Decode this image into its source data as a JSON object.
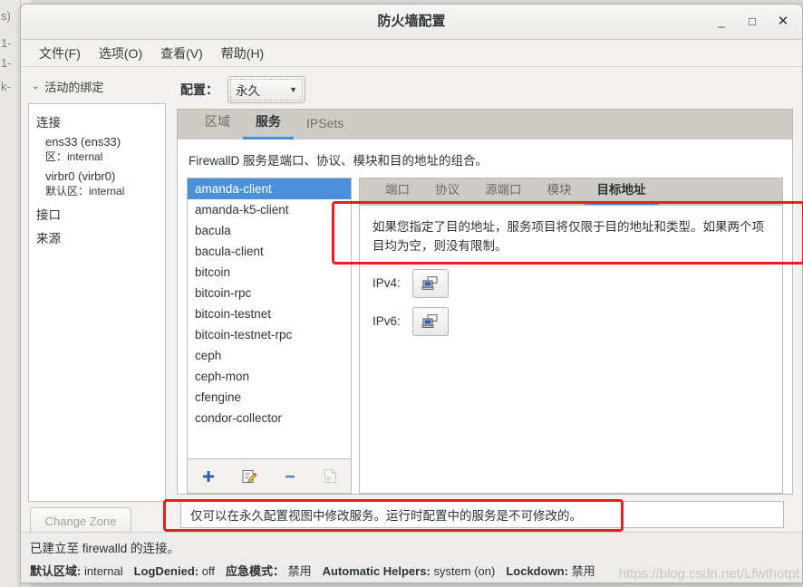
{
  "background": {
    "fragments": [
      "s)",
      "1-",
      "1-",
      "k-"
    ]
  },
  "window": {
    "title": "防火墙配置",
    "minimize_label": "_",
    "maximize_label": "□",
    "close_label": "✕"
  },
  "menubar": {
    "items": [
      {
        "label": "文件(F)"
      },
      {
        "label": "选项(O)"
      },
      {
        "label": "查看(V)"
      },
      {
        "label": "帮助(H)"
      }
    ]
  },
  "sidebar": {
    "binding_header": "活动的绑定",
    "chevron": "⌄",
    "tree": [
      {
        "label": "连接"
      },
      {
        "name": "ens33 (ens33)",
        "sub": "区：internal"
      },
      {
        "name": "virbr0 (virbr0)",
        "sub": "默认区：internal"
      },
      {
        "label": "接口"
      },
      {
        "label": "来源"
      }
    ],
    "change_zone_label": "Change Zone"
  },
  "config": {
    "label": "配置：",
    "selected": "永久",
    "arrow": "▼"
  },
  "notebook": {
    "tabs": [
      {
        "label": "区域",
        "active": false
      },
      {
        "label": "服务",
        "active": true
      },
      {
        "label": "IPSets",
        "active": false
      }
    ],
    "description": "FirewallD 服务是端口、协议、模块和目的地址的组合。"
  },
  "services": {
    "items": [
      {
        "label": "amanda-client",
        "selected": true
      },
      {
        "label": "amanda-k5-client",
        "selected": false
      },
      {
        "label": "bacula",
        "selected": false
      },
      {
        "label": "bacula-client",
        "selected": false
      },
      {
        "label": "bitcoin",
        "selected": false
      },
      {
        "label": "bitcoin-rpc",
        "selected": false
      },
      {
        "label": "bitcoin-testnet",
        "selected": false
      },
      {
        "label": "bitcoin-testnet-rpc",
        "selected": false
      },
      {
        "label": "ceph",
        "selected": false
      },
      {
        "label": "ceph-mon",
        "selected": false
      },
      {
        "label": "cfengine",
        "selected": false
      },
      {
        "label": "condor-collector",
        "selected": false
      }
    ],
    "toolbar": [
      {
        "icon": "add-icon",
        "glyph": "✚",
        "disabled": false
      },
      {
        "icon": "edit-icon",
        "glyph": "✎",
        "disabled": false
      },
      {
        "icon": "remove-icon",
        "glyph": "▬",
        "disabled": false
      },
      {
        "icon": "load-defaults-icon",
        "glyph": "⮐",
        "disabled": true
      }
    ]
  },
  "detail": {
    "tabs": [
      {
        "label": "端口",
        "active": false
      },
      {
        "label": "协议",
        "active": false
      },
      {
        "label": "源端口",
        "active": false
      },
      {
        "label": "模块",
        "active": false
      },
      {
        "label": "目标地址",
        "active": true
      }
    ],
    "hint": "如果您指定了目的地址，服务项目将仅限于目的地址和类型。如果两个项目均为空，则没有限制。",
    "ipv4_label": "IPv4:",
    "ipv4_value": "",
    "ipv6_label": "IPv6:",
    "ipv6_value": ""
  },
  "hintbar": {
    "text": "仅可以在永久配置视图中修改服务。运行时配置中的服务是不可修改的。"
  },
  "statusbar": {
    "connection": "已建立至 firewalld 的连接。",
    "fields": [
      {
        "key": "默认区域:",
        "value": "internal"
      },
      {
        "key": "LogDenied:",
        "value": "off"
      },
      {
        "key": "应急模式：",
        "value": "禁用"
      },
      {
        "key": "Automatic Helpers:",
        "value": "system (on)"
      },
      {
        "key": "Lockdown:",
        "value": "禁用"
      }
    ]
  },
  "watermark": {
    "text": "https://blog.csdn.net/Lfwthotpt"
  },
  "colors": {
    "selection": "#4a90d9",
    "annotation": "#ec1c24",
    "tab_underline": "#4a90d9"
  }
}
